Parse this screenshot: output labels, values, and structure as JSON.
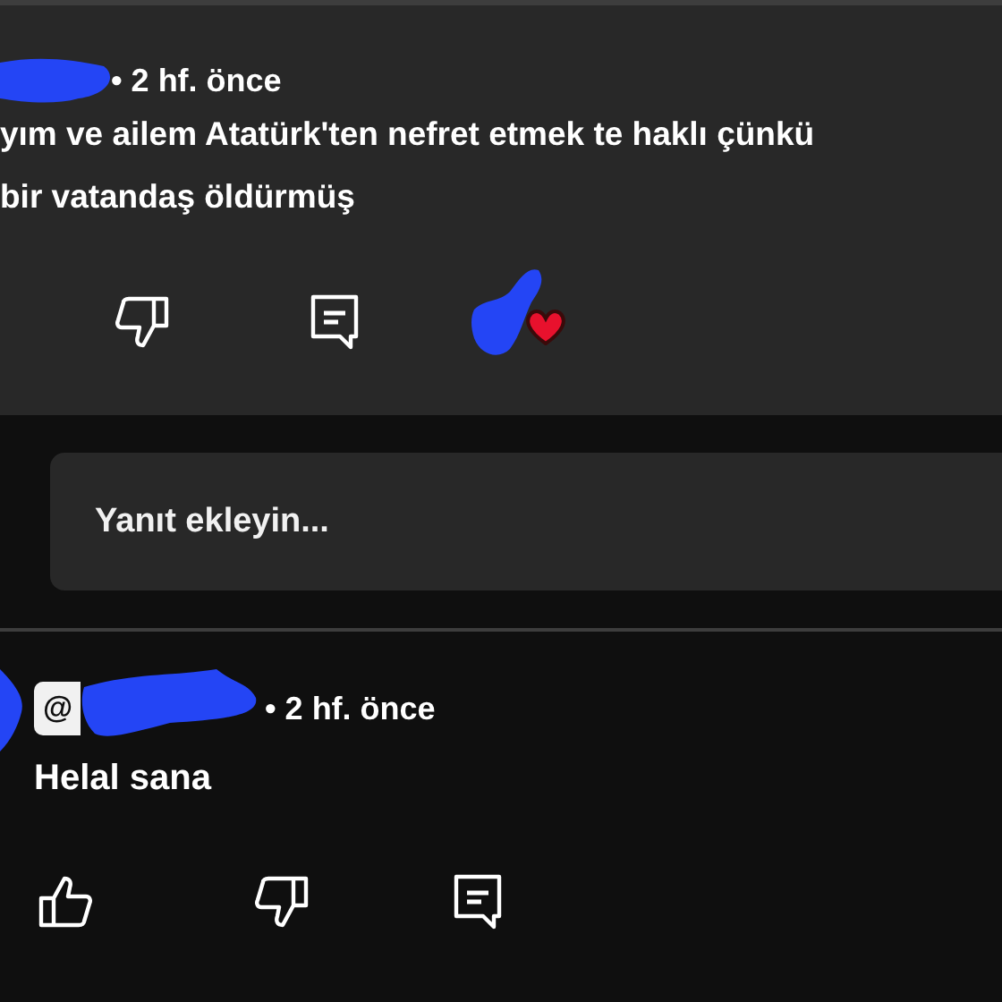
{
  "comments": [
    {
      "time": "• 2 hf. önce",
      "text_lines": [
        "yım ve ailem Atatürk'ten nefret etmek te haklı çünkü",
        "bir vatandaş öldürmüş"
      ],
      "actions": [
        {
          "kind": "dislike"
        },
        {
          "kind": "reply"
        }
      ],
      "hearted": true
    },
    {
      "time": "• 2 hf. önce",
      "text_lines": [
        "Helal sana"
      ],
      "actions": [
        {
          "kind": "like"
        },
        {
          "kind": "dislike"
        },
        {
          "kind": "reply"
        }
      ],
      "mention": "@"
    }
  ],
  "reply_field": {
    "placeholder": "Yanıt ekleyin..."
  }
}
